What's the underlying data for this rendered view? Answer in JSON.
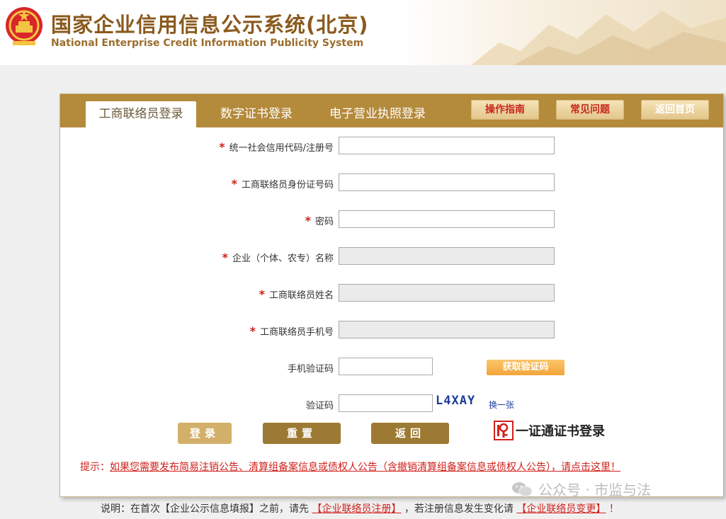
{
  "header": {
    "title_cn": "国家企业信用信息公示系统(北京)",
    "title_en": "National Enterprise Credit Information Publicity System",
    "emblem_icon": "national-emblem-icon"
  },
  "tabs": [
    {
      "label": "工商联络员登录",
      "active": true
    },
    {
      "label": "数字证书登录",
      "active": false
    },
    {
      "label": "电子营业执照登录",
      "active": false
    }
  ],
  "tab_buttons": {
    "guide": "操作指南",
    "faq": "常见问题",
    "home": "返回首页"
  },
  "form": {
    "credit_code_label": "统一社会信用代码/注册号",
    "id_number_label": "工商联络员身份证号码",
    "password_label": "密码",
    "enterprise_name_label": "企业（个体、农专）名称",
    "contact_name_label": "工商联络员姓名",
    "contact_phone_label": "工商联络员手机号",
    "sms_code_label": "手机验证码",
    "sms_button": "获取验证码",
    "captcha_label": "验证码",
    "captcha_text": "L4XAY",
    "captcha_refresh": "换一张",
    "required_mark": "*"
  },
  "actions": {
    "login": "登录",
    "reset": "重置",
    "back": "返回",
    "cert_login": "一证通证书登录"
  },
  "notice": {
    "prefix": "提示：",
    "link": "如果您需要发布简易注销公告、清算组备案信息或债权人公告（含撤销清算组备案信息或债权人公告），请点击这里！"
  },
  "footer": {
    "part1": "说明：在首次【企业公示信息填报】之前，请先",
    "link1": "【企业联络员注册】",
    "part2": "，若注册信息发生变化请",
    "link2": "【企业联络员变更】",
    "part3": "！"
  },
  "watermark": "公众号 · 市监与法",
  "colors": {
    "tab_bar": "#b48a3b",
    "button_brown": "#9d7a33",
    "button_light": "#d2b06a",
    "accent_red": "#d0211c",
    "title_brown": "#8a5a1e"
  }
}
